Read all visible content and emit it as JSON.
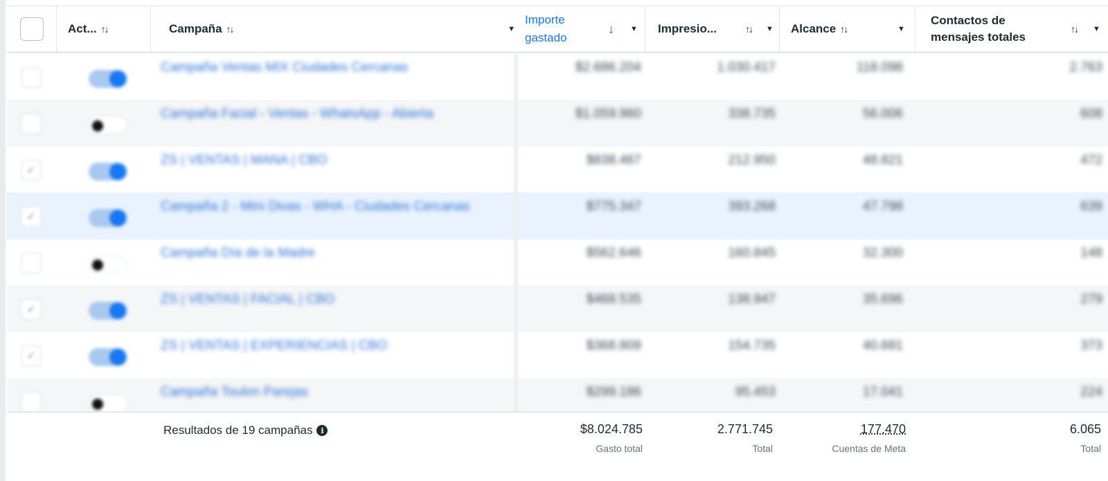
{
  "columns": {
    "active": "Act...",
    "campaign": "Campaña",
    "spend_line1": "Importe",
    "spend_line2": "gastado",
    "impressions": "Impresio...",
    "reach": "Alcance",
    "contacts_line1": "Contactos de",
    "contacts_line2": "mensajes totales"
  },
  "icons": {
    "sort": "sort-both-icon",
    "sort_desc": "arrow-down-icon",
    "dropdown": "caret-down-icon",
    "info": "info-icon"
  },
  "rows": [
    {
      "selected": false,
      "active": true,
      "name": "Campaña Ventas MIX Ciudades Cercanas",
      "spend": "$2.686.204",
      "impressions": "1.030.417",
      "reach": "118.098",
      "contacts": "2.763"
    },
    {
      "selected": false,
      "active": false,
      "name": "Campaña Facial - Ventas - WhatsApp - Abierta",
      "spend": "$1.059.960",
      "impressions": "338.735",
      "reach": "56.006",
      "contacts": "608"
    },
    {
      "selected": true,
      "active": true,
      "name": "ZS | VENTAS | MANA | CBO",
      "spend": "$838.467",
      "impressions": "212.950",
      "reach": "48.821",
      "contacts": "472"
    },
    {
      "selected": true,
      "active": true,
      "name": "Campaña 2 - Mini Divas - WHA - Ciudades Cercanas",
      "spend": "$775.347",
      "impressions": "393.268",
      "reach": "47.798",
      "contacts": "639"
    },
    {
      "selected": false,
      "active": false,
      "name": "Campaña Día de la Madre",
      "spend": "$562.646",
      "impressions": "160.845",
      "reach": "32.300",
      "contacts": "148"
    },
    {
      "selected": true,
      "active": true,
      "name": "ZS | VENTAS | FACIAL | CBO",
      "spend": "$468.535",
      "impressions": "138.947",
      "reach": "35.696",
      "contacts": "279"
    },
    {
      "selected": true,
      "active": true,
      "name": "ZS | VENTAS | EXPERIENCIAS | CBO",
      "spend": "$368.809",
      "impressions": "154.735",
      "reach": "40.681",
      "contacts": "373"
    },
    {
      "selected": false,
      "active": false,
      "name": "Campaña Toulon Parejas",
      "spend": "$299.186",
      "impressions": "95.453",
      "reach": "17.041",
      "contacts": "224"
    }
  ],
  "footer": {
    "label": "Resultados de 19 campañas",
    "spend_total": "$8.024.785",
    "spend_sub": "Gasto total",
    "impressions_total": "2.771.745",
    "impressions_sub": "Total",
    "reach_total": "177.470",
    "reach_sub": "Cuentas de Meta",
    "contacts_total": "6.065",
    "contacts_sub": "Total"
  },
  "colors": {
    "accent": "#1877f2",
    "link": "#2d6fd6",
    "toggle_on_track": "#a9c8f0",
    "selected_row": "#eaf3fd"
  }
}
